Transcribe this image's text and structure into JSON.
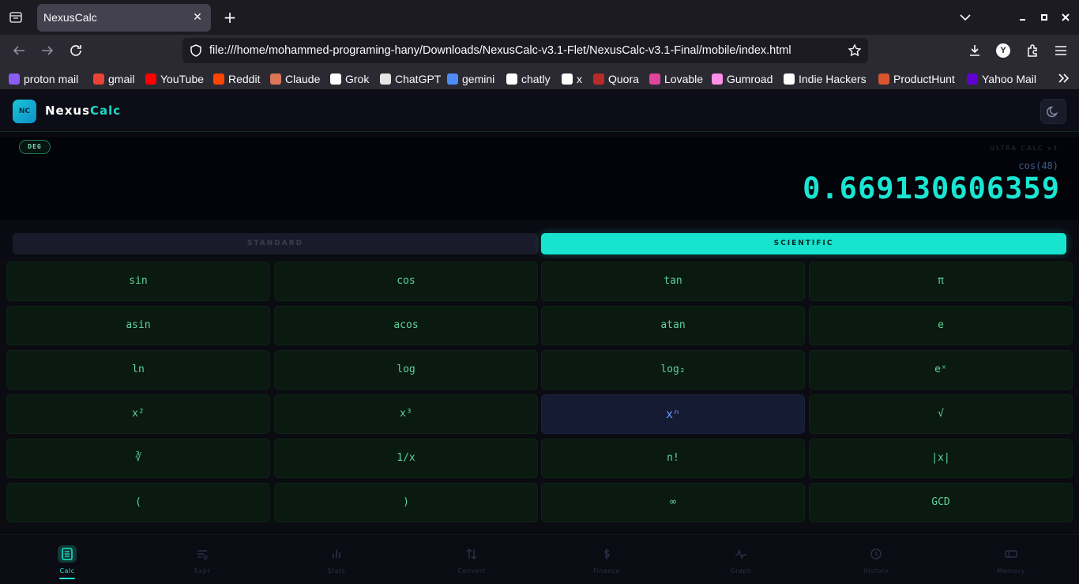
{
  "browser": {
    "tab_title": "NexusCalc",
    "url": "file:///home/mohammed-programing-hany/Downloads/NexusCalc-v3.1-Flet/NexusCalc-v3.1-Final/mobile/index.html",
    "bookmarks": [
      {
        "label": "proton mail",
        "icon": "proton-icon",
        "color": "#8b5cf6"
      },
      {
        "label": "gmail",
        "icon": "gmail-icon",
        "color": "#ea4335"
      },
      {
        "label": "YouTube",
        "icon": "youtube-icon",
        "color": "#ff0000"
      },
      {
        "label": "Reddit",
        "icon": "reddit-icon",
        "color": "#ff4500"
      },
      {
        "label": "Claude",
        "icon": "claude-icon",
        "color": "#d97757"
      },
      {
        "label": "Grok",
        "icon": "grok-icon",
        "color": "#ffffff"
      },
      {
        "label": "ChatGPT",
        "icon": "chatgpt-icon",
        "color": "#e5e5e5"
      },
      {
        "label": "gemini",
        "icon": "gemini-icon",
        "color": "#4e8cf7"
      },
      {
        "label": "chatly",
        "icon": "chatly-icon",
        "color": "#ffffff"
      },
      {
        "label": "x",
        "icon": "x-icon",
        "color": "#ffffff"
      },
      {
        "label": "Quora",
        "icon": "quora-icon",
        "color": "#b92b27"
      },
      {
        "label": "Lovable",
        "icon": "lovable-icon",
        "color": "#e0459a"
      },
      {
        "label": "Gumroad",
        "icon": "gumroad-icon",
        "color": "#ff90e8"
      },
      {
        "label": "Indie Hackers",
        "icon": "indiehackers-icon",
        "color": "#ffffff"
      },
      {
        "label": "ProductHunt",
        "icon": "producthunt-icon",
        "color": "#da552f"
      },
      {
        "label": "Yahoo Mail",
        "icon": "yahoo-icon",
        "color": "#6001d2"
      }
    ]
  },
  "app": {
    "logo_badge": "NC",
    "logo_part1": "Nexus",
    "logo_part2": "Calc",
    "angle_mode": "DEG",
    "brand_tag": "ULTRA CALC v3",
    "expression": "cos(48)",
    "result": "0.669130606359",
    "modes": {
      "standard": "STANDARD",
      "scientific": "SCIENTIFIC"
    },
    "keys": [
      [
        "sin",
        "cos",
        "tan",
        "π"
      ],
      [
        "asin",
        "acos",
        "atan",
        "e"
      ],
      [
        "ln",
        "log",
        "log₂",
        "eˣ"
      ],
      [
        "x²",
        "x³",
        "xⁿ",
        "√"
      ],
      [
        "∛",
        "1/x",
        "n!",
        "|x|"
      ],
      [
        "(",
        ")",
        "∞",
        "GCD"
      ]
    ],
    "active_key": "xⁿ",
    "nav": [
      {
        "label": "Calc",
        "icon": "calculator-icon"
      },
      {
        "label": "Expr",
        "icon": "expression-icon"
      },
      {
        "label": "Stats",
        "icon": "bar-chart-icon"
      },
      {
        "label": "Convert",
        "icon": "convert-arrows-icon"
      },
      {
        "label": "Finance",
        "icon": "dollar-icon"
      },
      {
        "label": "Graph",
        "icon": "pulse-icon"
      },
      {
        "label": "History",
        "icon": "clock-icon"
      },
      {
        "label": "Memory",
        "icon": "memory-icon"
      }
    ],
    "active_nav": "Calc"
  }
}
